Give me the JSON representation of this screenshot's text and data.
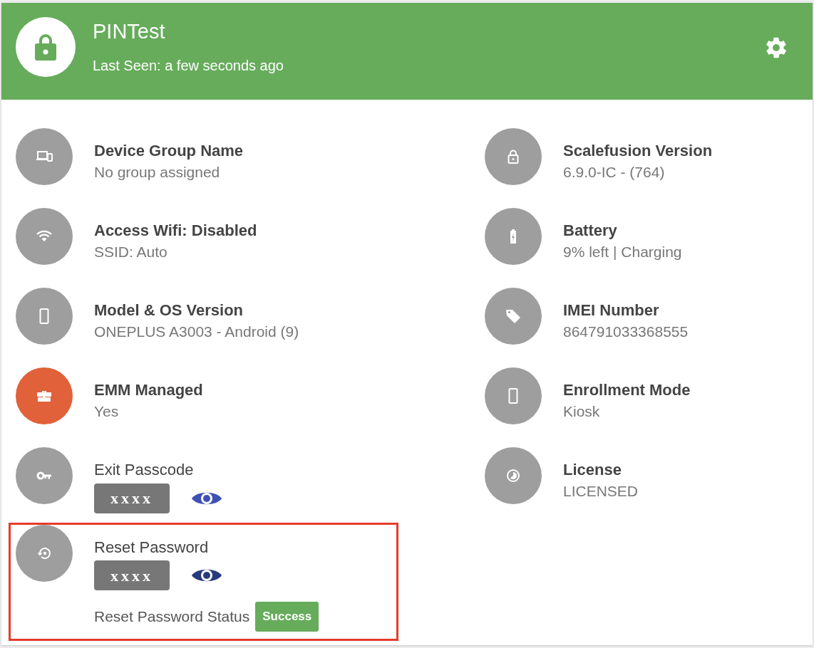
{
  "header": {
    "title": "PINTest",
    "subtitle": "Last Seen: a few seconds ago"
  },
  "columns": [
    {
      "items": [
        {
          "kind": "info",
          "title": "Device Group Name",
          "value": "No group assigned",
          "color": "#9e9e9e",
          "highlighted": false
        },
        {
          "kind": "info",
          "title": "Access Wifi: Disabled",
          "value": "SSID: Auto",
          "color": "#9e9e9e",
          "highlighted": false
        },
        {
          "kind": "info",
          "title": "Model & OS Version",
          "value": "ONEPLUS A3003 - Android (9)",
          "color": "#9e9e9e",
          "highlighted": false
        },
        {
          "kind": "info",
          "title": "EMM Managed",
          "value": "Yes",
          "color": "#e0613a",
          "highlighted": false
        },
        {
          "kind": "secret",
          "title": "Exit Passcode",
          "masked": "xxxx",
          "color": "#9e9e9e",
          "highlighted": false
        },
        {
          "kind": "secret",
          "title": "Reset Password",
          "masked": "xxxx",
          "color": "#9e9e9e",
          "highlighted": true,
          "status_label": "Reset Password Status",
          "status": "Success"
        }
      ]
    },
    {
      "items": [
        {
          "kind": "info",
          "title": "Scalefusion Version",
          "value": "6.9.0-IC - (764)",
          "color": "#9e9e9e",
          "highlighted": false
        },
        {
          "kind": "info",
          "title": "Battery",
          "value": "9% left | Charging",
          "color": "#9e9e9e",
          "highlighted": false
        },
        {
          "kind": "info",
          "title": "IMEI Number",
          "value": "864791033368555",
          "color": "#9e9e9e",
          "highlighted": false
        },
        {
          "kind": "info",
          "title": "Enrollment Mode",
          "value": "Kiosk",
          "color": "#9e9e9e",
          "highlighted": false
        },
        {
          "kind": "info",
          "title": "License",
          "value": "LICENSED",
          "color": "#9e9e9e",
          "highlighted": false
        }
      ]
    }
  ]
}
